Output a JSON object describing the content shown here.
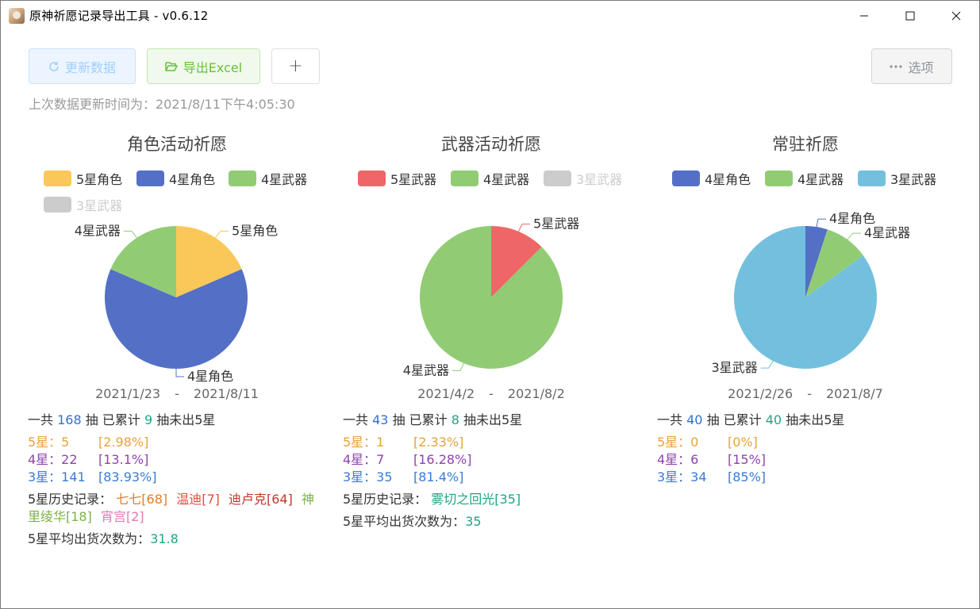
{
  "window": {
    "title": "原神祈愿记录导出工具 - v0.6.12"
  },
  "toolbar": {
    "refresh_label": "更新数据",
    "export_label": "导出Excel",
    "add_label": "+",
    "options_label": "选项",
    "last_update": "上次数据更新时间为：2021/8/11下午4:05:30"
  },
  "colors": {
    "five_char": "#fac858",
    "four_char": "#5470c6",
    "four_weapon": "#91cc75",
    "three_weapon": "#73c0de",
    "five_weapon": "#ee6666",
    "disabled": "#cccccc"
  },
  "panels": [
    {
      "title": "角色活动祈愿",
      "legend": [
        {
          "label": "5星角色",
          "color": "#fac858",
          "enabled": true
        },
        {
          "label": "4星角色",
          "color": "#5470c6",
          "enabled": true
        },
        {
          "label": "4星武器",
          "color": "#91cc75",
          "enabled": true
        },
        {
          "label": "3星武器",
          "color": "#cccccc",
          "enabled": false
        }
      ],
      "date_start": "2021/1/23",
      "date_sep": "-",
      "date_end": "2021/8/11",
      "summary": {
        "p1": "一共",
        "total": "168",
        "p2": "抽 已累计",
        "pity": "9",
        "p3": "抽未出5星"
      },
      "rows": [
        {
          "k": "5星：5",
          "v": "[2.98%]"
        },
        {
          "k": "4星：22",
          "v": "[13.1%]"
        },
        {
          "k": "3星：141",
          "v": "[83.93%]"
        }
      ],
      "history_label": "5星历史记录：",
      "history": [
        {
          "text": "七七[68]",
          "color": "#e67e22"
        },
        {
          "text": "温迪[7]",
          "color": "#e74c3c"
        },
        {
          "text": "迪卢克[64]",
          "color": "#c0392b"
        },
        {
          "text": "神里绫华[18]",
          "color": "#7cb342"
        },
        {
          "text": "宵宫[2]",
          "color": "#e07bb6"
        }
      ],
      "avg_label": "5星平均出货次数为：",
      "avg_value": "31.8"
    },
    {
      "title": "武器活动祈愿",
      "legend": [
        {
          "label": "5星武器",
          "color": "#ee6666",
          "enabled": true
        },
        {
          "label": "4星武器",
          "color": "#91cc75",
          "enabled": true
        },
        {
          "label": "3星武器",
          "color": "#cccccc",
          "enabled": false
        }
      ],
      "date_start": "2021/4/2",
      "date_sep": "-",
      "date_end": "2021/8/2",
      "summary": {
        "p1": "一共",
        "total": "43",
        "p2": "抽 已累计",
        "pity": "8",
        "p3": "抽未出5星"
      },
      "rows": [
        {
          "k": "5星：1",
          "v": "[2.33%]"
        },
        {
          "k": "4星：7",
          "v": "[16.28%]"
        },
        {
          "k": "3星：35",
          "v": "[81.4%]"
        }
      ],
      "history_label": "5星历史记录：",
      "history": [
        {
          "text": "雾切之回光[35]",
          "color": "#1ba784"
        }
      ],
      "avg_label": "5星平均出货次数为：",
      "avg_value": "35"
    },
    {
      "title": "常驻祈愿",
      "legend": [
        {
          "label": "4星角色",
          "color": "#5470c6",
          "enabled": true
        },
        {
          "label": "4星武器",
          "color": "#91cc75",
          "enabled": true
        },
        {
          "label": "3星武器",
          "color": "#73c0de",
          "enabled": true
        }
      ],
      "date_start": "2021/2/26",
      "date_sep": "-",
      "date_end": "2021/8/7",
      "summary": {
        "p1": "一共",
        "total": "40",
        "p2": "抽 已累计",
        "pity": "40",
        "p3": "抽未出5星"
      },
      "rows": [
        {
          "k": "5星：0",
          "v": "[0%]"
        },
        {
          "k": "4星：6",
          "v": "[15%]"
        },
        {
          "k": "3星：34",
          "v": "[85%]"
        }
      ]
    }
  ],
  "chart_data": [
    {
      "type": "pie",
      "title": "角色活动祈愿",
      "slices": [
        {
          "label": "5星角色",
          "value": 5
        },
        {
          "label": "4星角色",
          "value": 17
        },
        {
          "label": "4星武器",
          "value": 5
        }
      ]
    },
    {
      "type": "pie",
      "title": "武器活动祈愿",
      "slices": [
        {
          "label": "5星武器",
          "value": 1
        },
        {
          "label": "4星武器",
          "value": 7
        }
      ]
    },
    {
      "type": "pie",
      "title": "常驻祈愿",
      "slices": [
        {
          "label": "4星角色",
          "value": 2
        },
        {
          "label": "4星武器",
          "value": 4
        },
        {
          "label": "3星武器",
          "value": 34
        }
      ]
    }
  ]
}
